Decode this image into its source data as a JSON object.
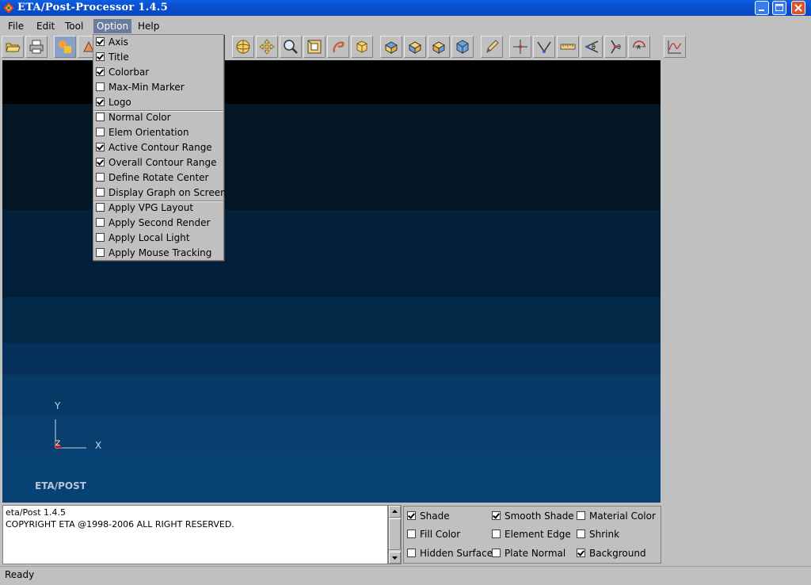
{
  "window": {
    "title": "ETA/Post-Processor 1.4.5"
  },
  "menubar": {
    "items": [
      "File",
      "Edit",
      "Tool",
      "Option",
      "Help"
    ],
    "active": "Option"
  },
  "toolbar": {
    "icons": [
      "open-folder-icon",
      "print-icon",
      "color-palette-icon",
      "partially-hidden-icon",
      "rotate-sphere-icon",
      "pan-icon",
      "zoom-icon",
      "zoom-window-icon",
      "rotate-curve-icon",
      "fit-cube-icon",
      "view-top-icon",
      "view-front-icon",
      "view-side-icon",
      "view-iso-icon",
      "brush-icon",
      "crosshair-icon",
      "vector-icon",
      "ruler-icon",
      "angle-icon",
      "angle-theta-icon",
      "radius-icon",
      "plot-graph-icon"
    ]
  },
  "option_menu": {
    "items": [
      {
        "label": "Axis",
        "checked": true
      },
      {
        "label": "Title",
        "checked": true
      },
      {
        "label": "Colorbar",
        "checked": true
      },
      {
        "label": "Max-Min Marker",
        "checked": false
      },
      {
        "label": "Logo",
        "checked": true
      },
      {
        "label": "Normal Color",
        "checked": false
      },
      {
        "label": "Elem Orientation",
        "checked": false
      },
      {
        "label": "Active Contour Range",
        "checked": true
      },
      {
        "label": "Overall Contour Range",
        "checked": true
      },
      {
        "label": "Define Rotate Center",
        "checked": false
      },
      {
        "label": "Display Graph on Screen",
        "checked": false
      },
      {
        "label": "Apply VPG Layout",
        "checked": false
      },
      {
        "label": "Apply Second Render",
        "checked": false
      },
      {
        "label": "Apply Local Light",
        "checked": false
      },
      {
        "label": "Apply Mouse Tracking",
        "checked": false
      }
    ]
  },
  "viewport": {
    "axis": {
      "y_label": "Y",
      "x_label": "X",
      "z_label": "Z"
    },
    "logo_text": "ETA/POST",
    "background_bands": [
      "#000000",
      "#010e19",
      "#021a2c",
      "#042640",
      "#053152",
      "#063c65",
      "#073f6a",
      "#083f72"
    ]
  },
  "log": {
    "lines": [
      "eta/Post 1.4.5",
      "COPYRIGHT ETA @1998-2006 ALL RIGHT RESERVED."
    ]
  },
  "options_panel": {
    "items": [
      {
        "label": "Shade",
        "checked": true
      },
      {
        "label": "Smooth Shade",
        "checked": true
      },
      {
        "label": "Material Color",
        "checked": false
      },
      {
        "label": "Fill Color",
        "checked": false
      },
      {
        "label": "Element Edge",
        "checked": false
      },
      {
        "label": "Shrink",
        "checked": false
      },
      {
        "label": "Hidden Surface",
        "checked": false
      },
      {
        "label": "Plate Normal",
        "checked": false
      },
      {
        "label": "Background",
        "checked": true
      }
    ]
  },
  "status": {
    "text": "Ready"
  }
}
